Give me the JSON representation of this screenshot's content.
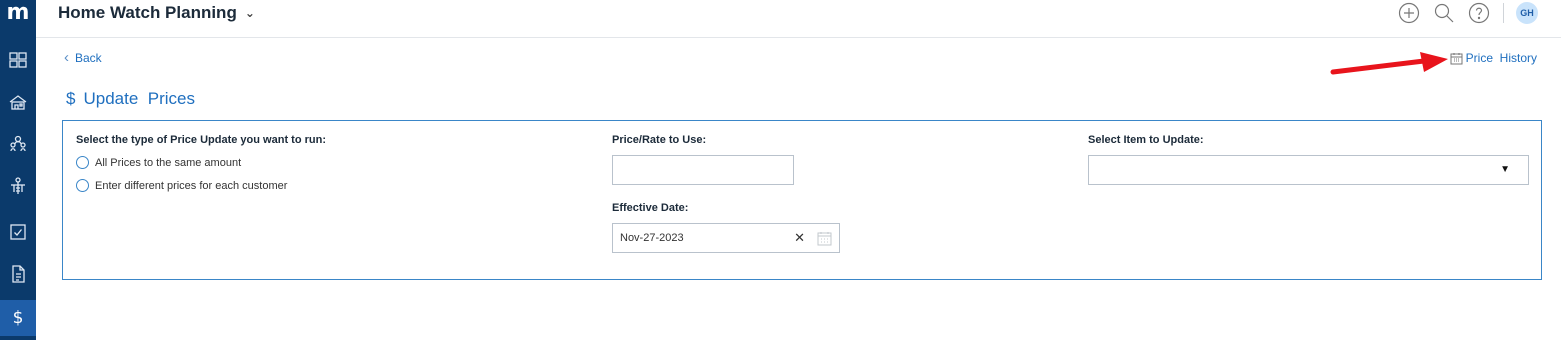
{
  "app": {
    "logo": "m",
    "title": "Home Watch Planning"
  },
  "topbar": {
    "icons": [
      "plus-circle-icon",
      "search-icon",
      "help-icon"
    ],
    "avatar_initials": "GH"
  },
  "sidebar": {
    "items": [
      "dashboard-icon",
      "properties-icon",
      "people-icon",
      "vendors-icon",
      "tasks-icon",
      "reports-icon",
      "pricing-icon"
    ],
    "active_index": 6,
    "active_glyph": "$",
    "colors": {
      "background": "#0b3a6b",
      "active": "#1f5ea8"
    }
  },
  "nav": {
    "back_label": "Back",
    "price_history_label": "Price  History"
  },
  "page": {
    "icon": "$",
    "title": "Update  Prices"
  },
  "form": {
    "price_type": {
      "label": "Select the type of Price Update you want to run:",
      "options": [
        "All Prices to the same amount",
        "Enter different prices for each customer"
      ]
    },
    "price_rate": {
      "label": "Price/Rate to Use:",
      "value": ""
    },
    "effective_date": {
      "label": "Effective Date:",
      "value": "Nov-27-2023",
      "clear_glyph": "✕"
    },
    "item": {
      "label": "Select Item to Update:",
      "value": "",
      "caret": "▼"
    }
  },
  "colors": {
    "accent": "#1f6fbf",
    "border": "#3a86c8",
    "annotation": "#e8141c"
  }
}
